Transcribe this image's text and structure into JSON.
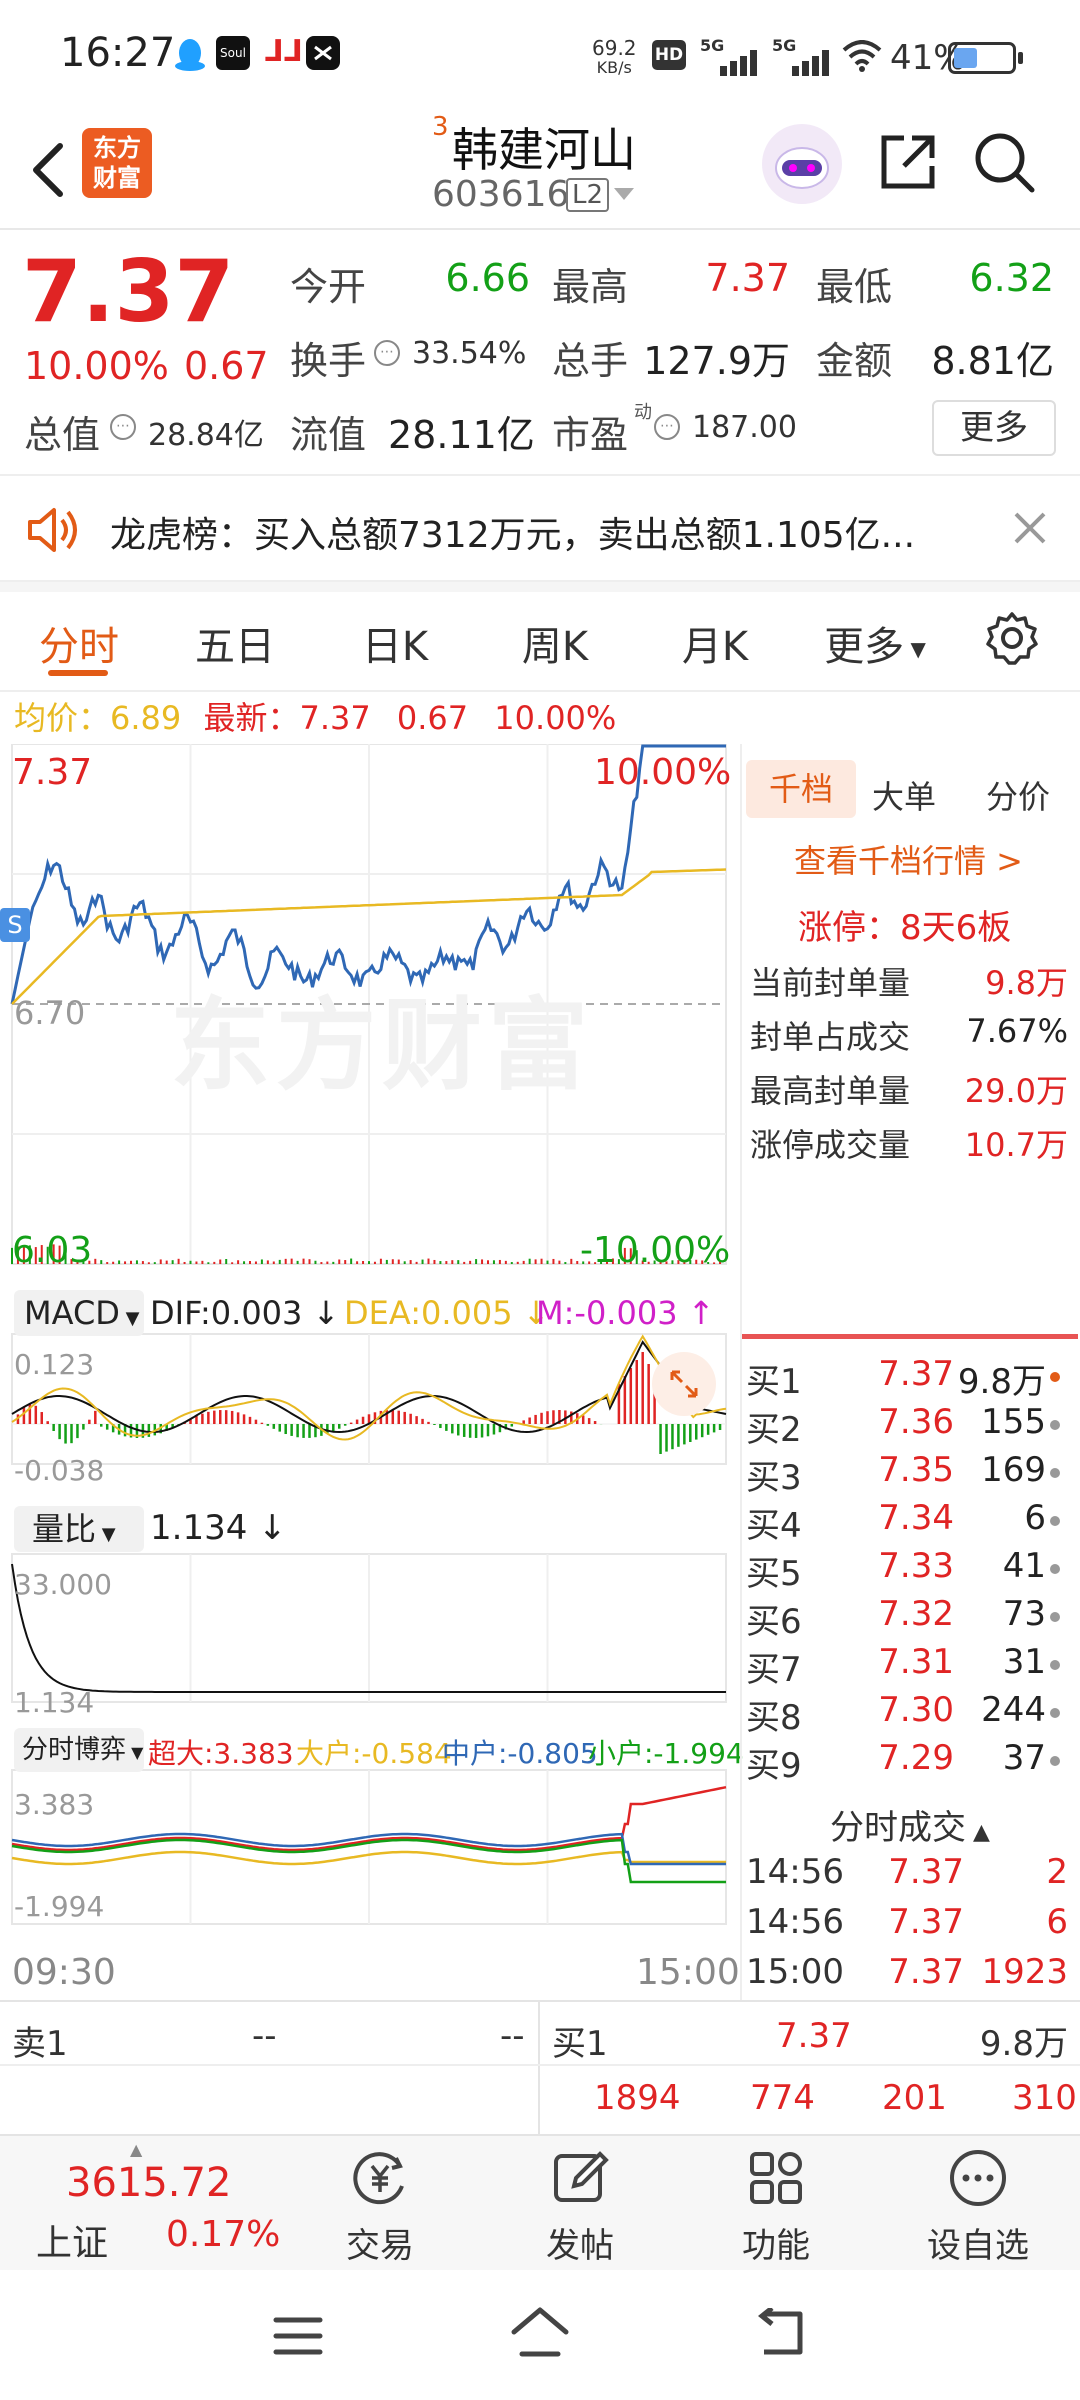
{
  "status_bar": {
    "time": "16:27",
    "net_speed_value": "69.2",
    "net_speed_unit": "KB/s",
    "hd": "HD",
    "sim1": "5G",
    "sim2": "5G",
    "battery_pct": "41%",
    "battery_level": 0.41
  },
  "header": {
    "superscript": "3",
    "stock_name": "韩建河山",
    "stock_code": "603616",
    "level_badge": "L2",
    "logo_top": "东方",
    "logo_bottom": "财富"
  },
  "quote": {
    "price": "7.37",
    "change_pct": "10.00%",
    "change_amt": "0.67",
    "open_label": "今开",
    "open": "6.66",
    "high_label": "最高",
    "high": "7.37",
    "low_label": "最低",
    "low": "6.32",
    "turnover_label": "换手",
    "turnover": "33.54%",
    "volume_label": "总手",
    "volume": "127.9万",
    "amount_label": "金额",
    "amount": "8.81亿",
    "mktcap_label": "总值",
    "mktcap": "28.84亿",
    "float_label": "流值",
    "float_cap": "28.11亿",
    "pe_label": "市盈",
    "pe_sup": "动",
    "pe": "187.00",
    "more_button": "更多"
  },
  "notice": {
    "text": "龙虎榜：买入总额7312万元，卖出总额1.105亿..."
  },
  "tabs": [
    "分时",
    "五日",
    "日K",
    "周K",
    "月K",
    "更多"
  ],
  "avg_line": {
    "avg_label": "均价：",
    "avg": "6.89",
    "latest_label": "最新：",
    "latest": "7.37",
    "chg": "0.67",
    "chg_pct": "10.00%"
  },
  "main_chart": {
    "y_top": "7.37",
    "y_bottom": "6.03",
    "pct_top": "10.00%",
    "pct_bottom": "-10.00%",
    "prev_close": "6.70",
    "s_badge": "S",
    "watermark": "东方财富"
  },
  "macd": {
    "selector": "MACD",
    "dif": "DIF:0.003 ↓",
    "dea": "DEA:0.005 ↓",
    "m": "M:-0.003 ↑",
    "top": "0.123",
    "bottom": "-0.038"
  },
  "vol_ratio": {
    "selector": "量比",
    "value": "1.134 ↓",
    "top": "33.000",
    "bottom": "1.134"
  },
  "flow": {
    "selector": "分时博弈",
    "super_big": "超大:3.383",
    "big": "大户:-0.584",
    "mid": "中户:-0.805",
    "small": "小户:-1.994",
    "top": "3.383",
    "bottom": "-1.994"
  },
  "time_axis": {
    "start": "09:30",
    "end": "15:00"
  },
  "right_panel": {
    "tabs": [
      "千档",
      "大单",
      "分价"
    ],
    "link": "查看千档行情 >",
    "limit_up": "涨停：8天6板",
    "stats": [
      {
        "label": "当前封单量",
        "value": "9.8万"
      },
      {
        "label": "封单占成交",
        "value": "7.67%"
      },
      {
        "label": "最高封单量",
        "value": "29.0万"
      },
      {
        "label": "涨停成交量",
        "value": "10.7万"
      }
    ],
    "bids": [
      {
        "label": "买1",
        "price": "7.37",
        "vol": "9.8万"
      },
      {
        "label": "买2",
        "price": "7.36",
        "vol": "155"
      },
      {
        "label": "买3",
        "price": "7.35",
        "vol": "169"
      },
      {
        "label": "买4",
        "price": "7.34",
        "vol": "6"
      },
      {
        "label": "买5",
        "price": "7.33",
        "vol": "41"
      },
      {
        "label": "买6",
        "price": "7.32",
        "vol": "73"
      },
      {
        "label": "买7",
        "price": "7.31",
        "vol": "31"
      },
      {
        "label": "买8",
        "price": "7.30",
        "vol": "244"
      },
      {
        "label": "买9",
        "price": "7.29",
        "vol": "37"
      }
    ],
    "ticks_title": "分时成交",
    "ticks": [
      {
        "time": "14:56",
        "price": "7.37",
        "vol": "2"
      },
      {
        "time": "14:56",
        "price": "7.37",
        "vol": "6"
      },
      {
        "time": "15:00",
        "price": "7.37",
        "vol": "1923"
      }
    ]
  },
  "bottom_quote": {
    "sell_label": "卖1",
    "sell_price": "--",
    "sell_vol": "--",
    "buy_label": "买1",
    "buy_price": "7.37",
    "buy_vol": "9.8万",
    "queue": [
      "1894",
      "774",
      "201",
      "310"
    ]
  },
  "nav": {
    "index_value": "3615.72",
    "index_name": "上证",
    "index_pct": "0.17%",
    "items": [
      "交易",
      "发帖",
      "功能",
      "设自选"
    ]
  },
  "colors": {
    "up": "#e02424",
    "down": "#13a017",
    "accent": "#e25b16",
    "price_line": "#2f68b5",
    "avg_line": "#e8b923"
  }
}
